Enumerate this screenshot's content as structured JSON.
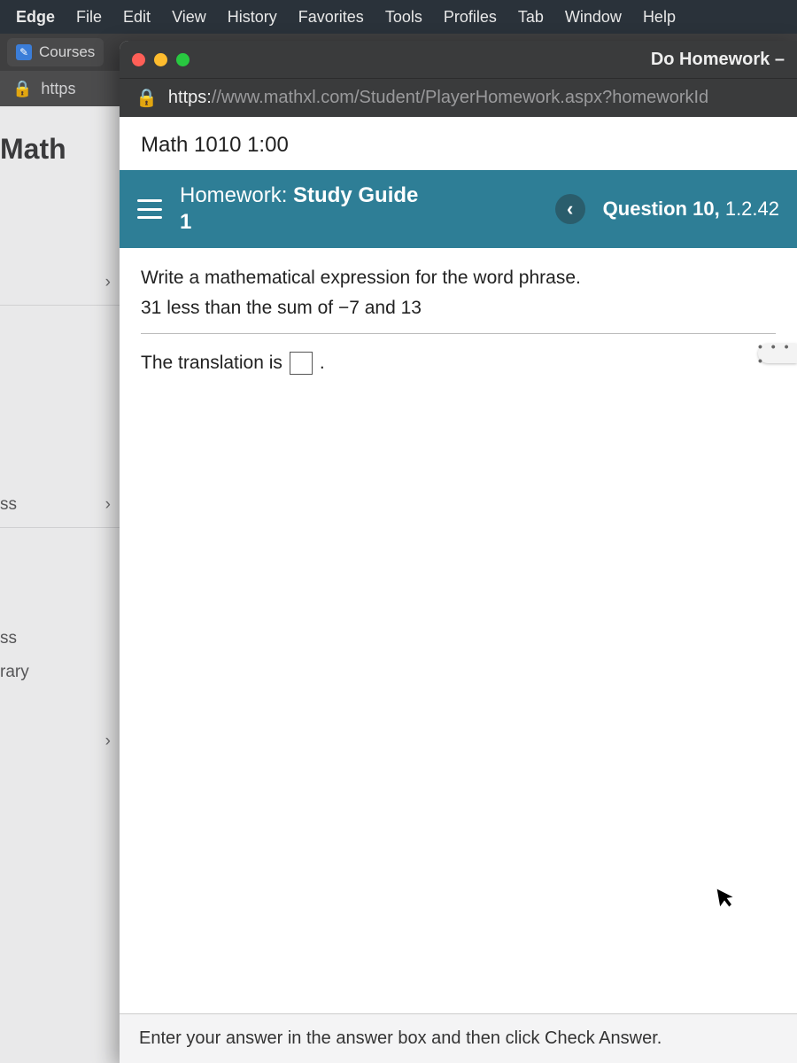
{
  "menubar": {
    "app": "Edge",
    "items": [
      "File",
      "Edit",
      "View",
      "History",
      "Favorites",
      "Tools",
      "Profiles",
      "Tab",
      "Window",
      "Help"
    ]
  },
  "bg_browser": {
    "tab_label": "Courses",
    "addr_text": "https",
    "page_title": "Math",
    "sidebar": {
      "items": [
        "",
        "ss",
        "ss",
        "rary"
      ]
    }
  },
  "popup": {
    "window_title": "Do Homework –",
    "addr_scheme": "https:",
    "addr_rest": "//www.mathxl.com/Student/PlayerHomework.aspx?homeworkId",
    "course_title": "Math 1010 1:00",
    "homework_label": "Homework:",
    "homework_name": "Study Guide 1",
    "question_label_prefix": "Question ",
    "question_number": "10,",
    "question_ref": "1.2.42",
    "prompt": "Write a mathematical expression for the word phrase.",
    "phrase": "31 less than the sum of −7 and 13",
    "translation_prefix": "The translation is",
    "translation_suffix": ".",
    "more_dots": "• • • •",
    "footer": "Enter your answer in the answer box and then click Check Answer."
  },
  "icons": {
    "lock": "🔒",
    "chevron_right": "›",
    "chevron_left": "‹",
    "cursor": "➤"
  }
}
